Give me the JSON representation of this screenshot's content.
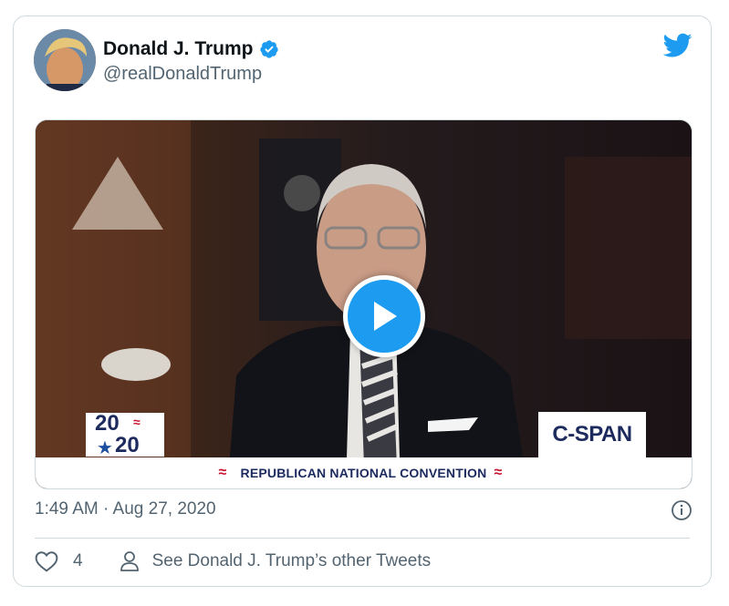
{
  "author": {
    "name": "Donald J. Trump",
    "handle": "@realDonaldTrump",
    "verified": true
  },
  "media": {
    "type": "video",
    "banner_text": "REPUBLICAN NATIONAL CONVENTION",
    "logo_left_top": "20",
    "logo_left_bottom": "20",
    "logo_right": "C-SPAN"
  },
  "tweet": {
    "timestamp": "1:49 AM · Aug 27, 2020"
  },
  "actions": {
    "like_count": "4",
    "other_tweets_label": "See Donald J. Trump’s other Tweets"
  },
  "colors": {
    "twitter_blue": "#1d9bf0",
    "text_secondary": "#536471",
    "border": "#cfd9de"
  }
}
